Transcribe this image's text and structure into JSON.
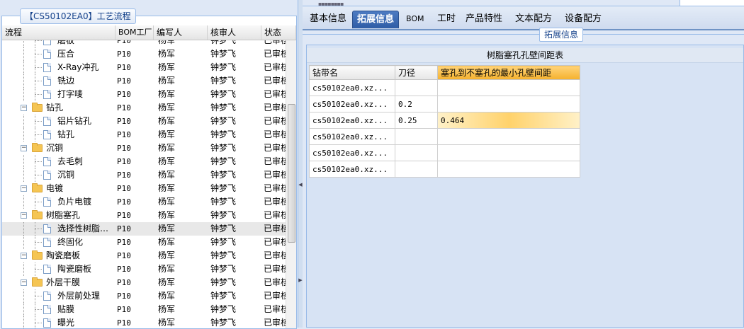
{
  "left_panel": {
    "title": "【CS50102EA0】工艺流程",
    "columns": [
      "流程",
      "BOM工厂",
      "编写人",
      "核审人",
      "状态"
    ],
    "rows": [
      {
        "type": "leaf",
        "name": "磨板",
        "bom": "P10",
        "writer": "杨军",
        "reviewer": "钟梦飞",
        "status": "已审核"
      },
      {
        "type": "leaf",
        "name": "压合",
        "bom": "P10",
        "writer": "杨军",
        "reviewer": "钟梦飞",
        "status": "已审核"
      },
      {
        "type": "leaf",
        "name": "X-Ray冲孔",
        "bom": "P10",
        "writer": "杨军",
        "reviewer": "钟梦飞",
        "status": "已审核"
      },
      {
        "type": "leaf",
        "name": "铣边",
        "bom": "P10",
        "writer": "杨军",
        "reviewer": "钟梦飞",
        "status": "已审核"
      },
      {
        "type": "leaf",
        "name": "打字唛",
        "bom": "P10",
        "writer": "杨军",
        "reviewer": "钟梦飞",
        "status": "已审核"
      },
      {
        "type": "folder",
        "name": "钻孔",
        "bom": "P10",
        "writer": "杨军",
        "reviewer": "钟梦飞",
        "status": "已审核"
      },
      {
        "type": "leaf",
        "name": "铝片钻孔",
        "bom": "P10",
        "writer": "杨军",
        "reviewer": "钟梦飞",
        "status": "已审核"
      },
      {
        "type": "leaf",
        "name": "钻孔",
        "bom": "P10",
        "writer": "杨军",
        "reviewer": "钟梦飞",
        "status": "已审核"
      },
      {
        "type": "folder",
        "name": "沉铜",
        "bom": "P10",
        "writer": "杨军",
        "reviewer": "钟梦飞",
        "status": "已审核"
      },
      {
        "type": "leaf",
        "name": "去毛刺",
        "bom": "P10",
        "writer": "杨军",
        "reviewer": "钟梦飞",
        "status": "已审核"
      },
      {
        "type": "leaf",
        "name": "沉铜",
        "bom": "P10",
        "writer": "杨军",
        "reviewer": "钟梦飞",
        "status": "已审核"
      },
      {
        "type": "folder",
        "name": "电镀",
        "bom": "P10",
        "writer": "杨军",
        "reviewer": "钟梦飞",
        "status": "已审核"
      },
      {
        "type": "leaf",
        "name": "负片电镀",
        "bom": "P10",
        "writer": "杨军",
        "reviewer": "钟梦飞",
        "status": "已审核"
      },
      {
        "type": "folder",
        "name": "树脂塞孔",
        "bom": "P10",
        "writer": "杨军",
        "reviewer": "钟梦飞",
        "status": "已审核"
      },
      {
        "type": "leaf",
        "name": "选择性树脂…",
        "bom": "P10",
        "writer": "杨军",
        "reviewer": "钟梦飞",
        "status": "已审核",
        "selected": true
      },
      {
        "type": "leaf",
        "name": "终固化",
        "bom": "P10",
        "writer": "杨军",
        "reviewer": "钟梦飞",
        "status": "已审核"
      },
      {
        "type": "folder",
        "name": "陶瓷磨板",
        "bom": "P10",
        "writer": "杨军",
        "reviewer": "钟梦飞",
        "status": "已审核"
      },
      {
        "type": "leaf",
        "name": "陶瓷磨板",
        "bom": "P10",
        "writer": "杨军",
        "reviewer": "钟梦飞",
        "status": "已审核"
      },
      {
        "type": "folder",
        "name": "外层干膜",
        "bom": "P10",
        "writer": "杨军",
        "reviewer": "钟梦飞",
        "status": "已审核"
      },
      {
        "type": "leaf",
        "name": "外层前处理",
        "bom": "P10",
        "writer": "杨军",
        "reviewer": "钟梦飞",
        "status": "已审核"
      },
      {
        "type": "leaf",
        "name": "贴膜",
        "bom": "P10",
        "writer": "杨军",
        "reviewer": "钟梦飞",
        "status": "已审核"
      },
      {
        "type": "leaf",
        "name": "曝光",
        "bom": "P10",
        "writer": "杨军",
        "reviewer": "钟梦飞",
        "status": "已审核"
      }
    ]
  },
  "tabs": [
    {
      "label": "基本信息",
      "active": false
    },
    {
      "label": "拓展信息",
      "active": true
    },
    {
      "label": "BOM",
      "active": false
    },
    {
      "label": "工时",
      "active": false
    },
    {
      "label": "产品特性",
      "active": false
    },
    {
      "label": "文本配方",
      "active": false
    },
    {
      "label": "设备配方",
      "active": false
    }
  ],
  "extension": {
    "section_label": "拓展信息",
    "table_title": "树脂塞孔孔壁间距表",
    "columns": [
      "钻带名",
      "刀径",
      "塞孔到不塞孔的最小孔壁间距"
    ],
    "rows": [
      {
        "name": "cs50102ea0.xz...",
        "diameter": "",
        "spacing": ""
      },
      {
        "name": "cs50102ea0.xz...",
        "diameter": "0.2",
        "spacing": ""
      },
      {
        "name": "cs50102ea0.xz...",
        "diameter": "0.25",
        "spacing": "0.464",
        "highlight": true
      },
      {
        "name": "cs50102ea0.xz...",
        "diameter": "",
        "spacing": ""
      },
      {
        "name": "cs50102ea0.xz...",
        "diameter": "",
        "spacing": ""
      },
      {
        "name": "cs50102ea0.xz...",
        "diameter": "",
        "spacing": ""
      }
    ]
  },
  "colors": {
    "panel_bg": "#dfe8f6",
    "border": "#99bbe8",
    "active_tab": "#3a66b0",
    "highlight": "#f5b12d"
  },
  "icons": {
    "folder": "folder-icon",
    "document": "document-icon",
    "tree_toggle": "tree-toggle-icon"
  }
}
